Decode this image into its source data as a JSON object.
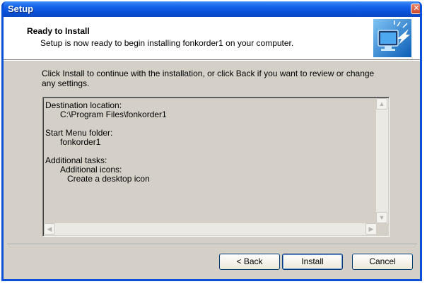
{
  "window": {
    "title": "Setup",
    "close_glyph": "✕"
  },
  "header": {
    "title": "Ready to Install",
    "subtitle": "Setup is now ready to begin installing fonkorder1 on your computer.",
    "icon": "setup-monitor-icon"
  },
  "instruction": "Click Install to continue with the installation, or click Back if you want to review or change any settings.",
  "memo": {
    "destination_label": "Destination location:",
    "destination_value": "C:\\Program Files\\fonkorder1",
    "start_menu_label": "Start Menu folder:",
    "start_menu_value": "fonkorder1",
    "tasks_label": "Additional tasks:",
    "tasks_group": "Additional icons:",
    "tasks_item": "Create a desktop icon"
  },
  "scrollbar_glyphs": {
    "up": "▲",
    "down": "▼",
    "left": "◀",
    "right": "▶"
  },
  "buttons": {
    "back": "< Back",
    "install": "Install",
    "cancel": "Cancel"
  }
}
